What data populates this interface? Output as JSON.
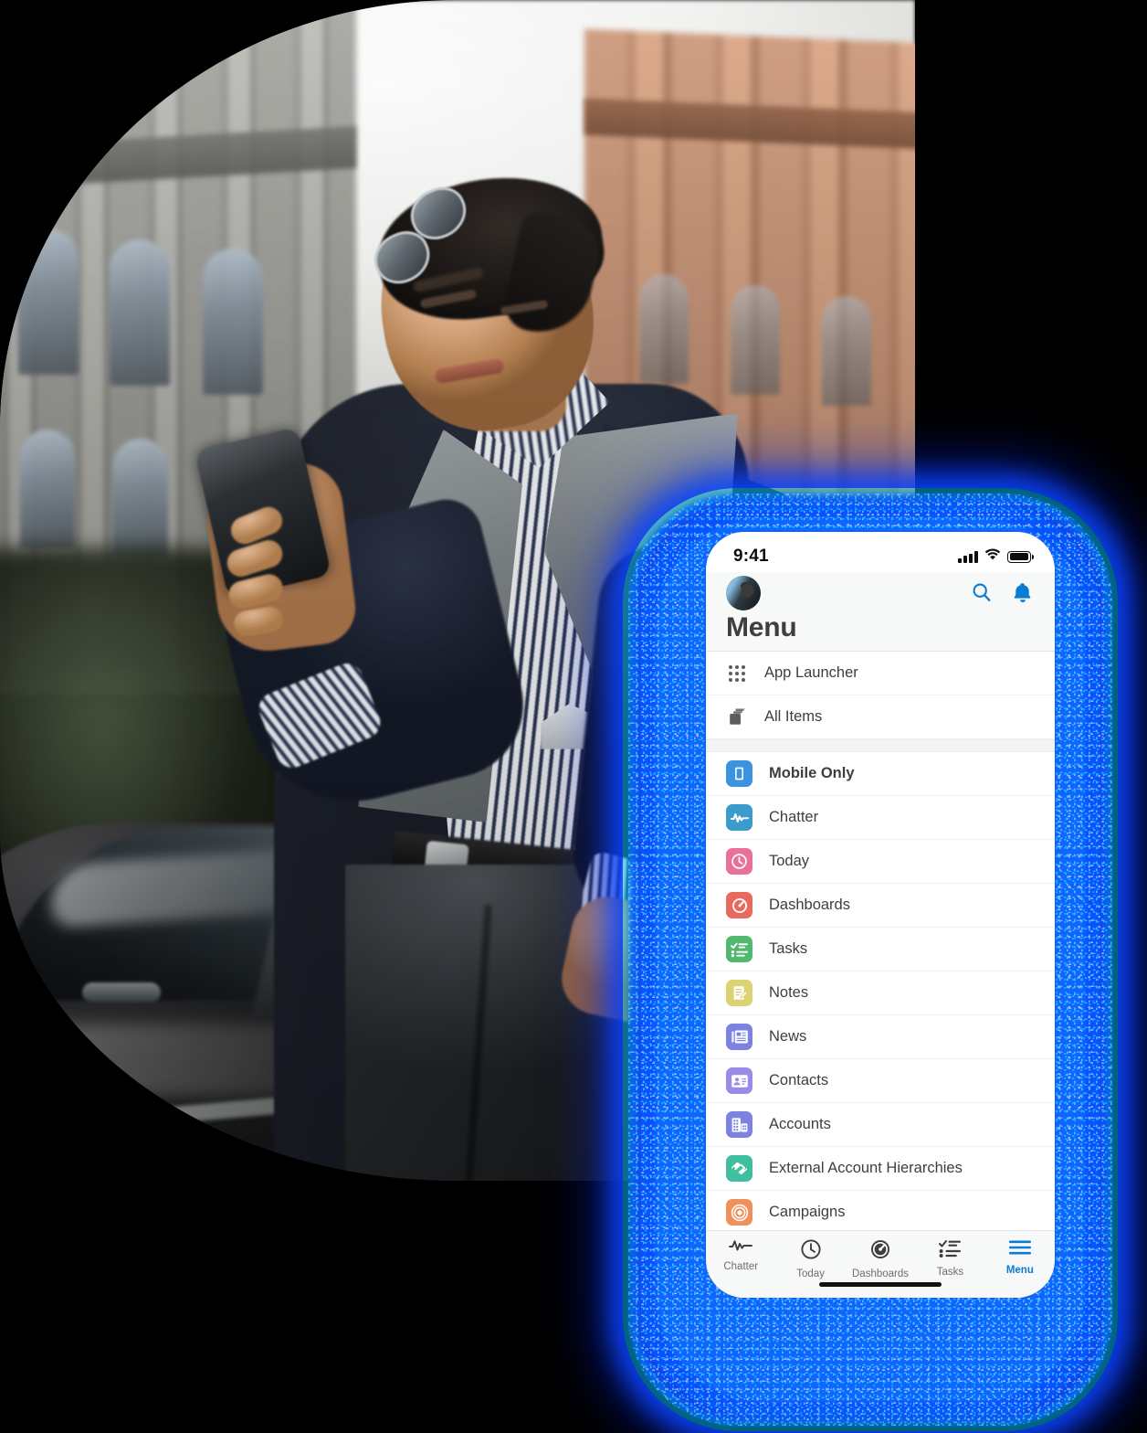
{
  "photo": {
    "alt_description": "Businessman in navy suit looking at smartphone beside a dark car",
    "shape": "rounded-left-mask"
  },
  "device": {
    "status_bar": {
      "time": "9:41",
      "signal_icon": "cellular-bars-icon",
      "wifi_icon": "wifi-icon",
      "battery_icon": "battery-full-icon"
    },
    "home_indicator": "home-indicator"
  },
  "glow": {
    "color": "#0b4ef0",
    "accent": "#00d8ff",
    "name": "blue-glow-halo"
  },
  "header": {
    "avatar_label": "user-avatar",
    "title": "Menu",
    "search_icon": "search-icon",
    "notification_icon": "bell-icon",
    "icon_color": "#0b7cd4",
    "background": "#f7f8f8",
    "title_color": "#3e3e3c"
  },
  "menu": {
    "top_items": [
      {
        "label": "App Launcher",
        "icon": "app-launcher-grid-icon",
        "icon_style": "glyph"
      },
      {
        "label": "All Items",
        "icon": "all-items-stack-icon",
        "icon_style": "glyph"
      }
    ],
    "items": [
      {
        "label": "Mobile Only",
        "icon": "mobile-phone-icon",
        "color": "#3b93e0",
        "bold": true
      },
      {
        "label": "Chatter",
        "icon": "chatter-pulse-icon",
        "color": "#3b9ccc",
        "bold": false
      },
      {
        "label": "Today",
        "icon": "clock-icon",
        "color": "#e8719c",
        "bold": false
      },
      {
        "label": "Dashboards",
        "icon": "gauge-icon",
        "color": "#e8695d",
        "bold": false
      },
      {
        "label": "Tasks",
        "icon": "checklist-icon",
        "color": "#52b86e",
        "bold": false
      },
      {
        "label": "Notes",
        "icon": "note-pencil-icon",
        "color": "#ddd272",
        "bold": false
      },
      {
        "label": "News",
        "icon": "newspaper-icon",
        "color": "#7c82e0",
        "bold": false
      },
      {
        "label": "Contacts",
        "icon": "contact-card-icon",
        "color": "#9b8ae8",
        "bold": false
      },
      {
        "label": "Accounts",
        "icon": "building-icon",
        "color": "#7c82e0",
        "bold": false
      },
      {
        "label": "External Account Hierarchies",
        "icon": "handshake-icon",
        "color": "#3fbfa0",
        "bold": false
      },
      {
        "label": "Campaigns",
        "icon": "target-rings-icon",
        "color": "#f0905a",
        "bold": false
      }
    ]
  },
  "tabbar": {
    "items": [
      {
        "label": "Chatter",
        "icon": "chatter-pulse-icon",
        "active": false
      },
      {
        "label": "Today",
        "icon": "clock-icon",
        "active": false
      },
      {
        "label": "Dashboards",
        "icon": "gauge-icon",
        "active": false
      },
      {
        "label": "Tasks",
        "icon": "checklist-icon",
        "active": false
      },
      {
        "label": "Menu",
        "icon": "hamburger-icon",
        "active": true
      }
    ],
    "active_color": "#0b7cd4",
    "inactive_color": "#706e6b"
  }
}
